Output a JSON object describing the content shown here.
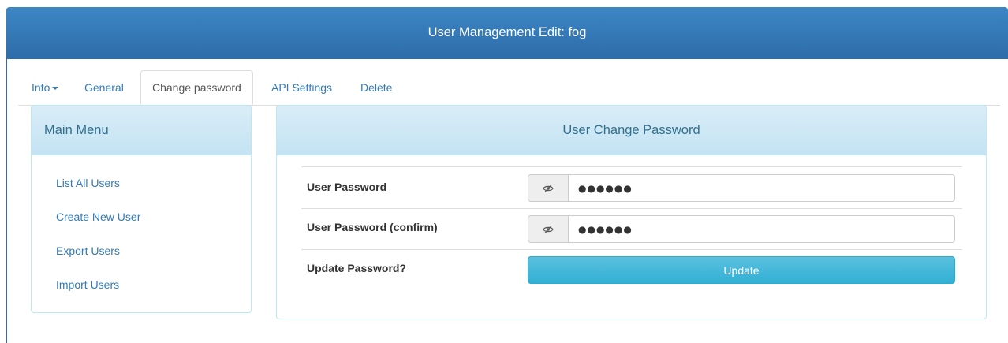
{
  "header": {
    "title": "User Management Edit: fog"
  },
  "tabs": [
    {
      "label": "Info",
      "active": false,
      "has_dropdown": true
    },
    {
      "label": "General",
      "active": false
    },
    {
      "label": "Change password",
      "active": true
    },
    {
      "label": "API Settings",
      "active": false
    },
    {
      "label": "Delete",
      "active": false
    }
  ],
  "menu": {
    "title": "Main Menu",
    "items": [
      {
        "label": "List All Users"
      },
      {
        "label": "Create New User"
      },
      {
        "label": "Export Users"
      },
      {
        "label": "Import Users"
      }
    ]
  },
  "form": {
    "title": "User Change Password",
    "password_label": "User Password",
    "password_value": "●●●●●●",
    "confirm_label": "User Password (confirm)",
    "confirm_value": "●●●●●●",
    "update_label": "Update Password?",
    "update_button": "Update",
    "toggle_icon": "eye-slash-icon"
  },
  "colors": {
    "header": "#2f72b0",
    "link": "#337ab7",
    "panel_heading": "#d9edf7",
    "panel_border": "#bce8f1",
    "info_button": "#31b0d5"
  }
}
